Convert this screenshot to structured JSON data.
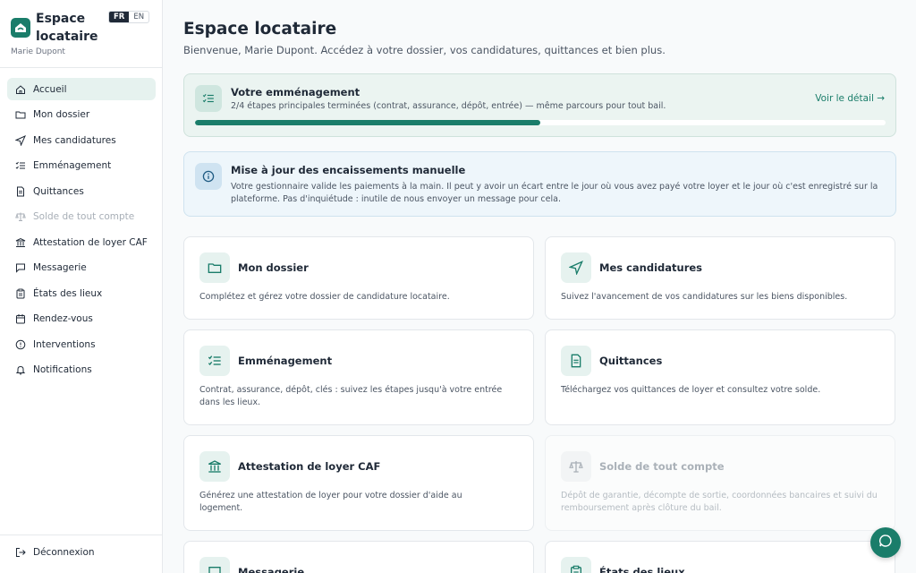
{
  "brand": {
    "name": "Espace locataire",
    "user": "Marie Dupont"
  },
  "lang": {
    "fr": "FR",
    "en": "EN"
  },
  "nav": [
    {
      "label": "Accueil",
      "icon": "home-icon",
      "active": true
    },
    {
      "label": "Mon dossier",
      "icon": "folder-icon"
    },
    {
      "label": "Mes candidatures",
      "icon": "send-icon"
    },
    {
      "label": "Emménagement",
      "icon": "checklist-icon"
    },
    {
      "label": "Quittances",
      "icon": "document-icon"
    },
    {
      "label": "Solde de tout compte",
      "icon": "scale-icon",
      "disabled": true
    },
    {
      "label": "Attestation de loyer CAF",
      "icon": "bank-icon"
    },
    {
      "label": "Messagerie",
      "icon": "message-icon"
    },
    {
      "label": "États des lieux",
      "icon": "clipboard-icon"
    },
    {
      "label": "Rendez-vous",
      "icon": "calendar-icon"
    },
    {
      "label": "Interventions",
      "icon": "alert-circle-icon"
    },
    {
      "label": "Notifications",
      "icon": "bell-icon"
    }
  ],
  "logout": {
    "label": "Déconnexion",
    "icon": "logout-icon"
  },
  "main": {
    "title": "Espace locataire",
    "subtitle": "Bienvenue, Marie Dupont. Accédez à votre dossier, vos candidatures, quittances et bien plus."
  },
  "progress": {
    "title": "Votre emménagement",
    "description": "2/4 étapes principales terminées (contrat, assurance, dépôt, entrée) — même parcours pour tout bail.",
    "link": "Voir le détail →",
    "fraction": 0.5
  },
  "info": {
    "title": "Mise à jour des encaissements manuelle",
    "description": "Votre gestionnaire valide les paiements à la main. Il peut y avoir un écart entre le jour où vous avez payé votre loyer et le jour où c'est enregistré sur la plateforme. Pas d'inquiétude : inutile de nous envoyer un message pour cela."
  },
  "tiles": [
    {
      "title": "Mon dossier",
      "description": "Complétez et gérez votre dossier de candidature locataire.",
      "icon": "folder-icon"
    },
    {
      "title": "Mes candidatures",
      "description": "Suivez l'avancement de vos candidatures sur les biens disponibles.",
      "icon": "send-icon"
    },
    {
      "title": "Emménagement",
      "description": "Contrat, assurance, dépôt, clés : suivez les étapes jusqu'à votre entrée dans les lieux.",
      "icon": "checklist-icon"
    },
    {
      "title": "Quittances",
      "description": "Téléchargez vos quittances de loyer et consultez votre solde.",
      "icon": "document-icon"
    },
    {
      "title": "Attestation de loyer CAF",
      "description": "Générez une attestation de loyer pour votre dossier d'aide au logement.",
      "icon": "bank-icon"
    },
    {
      "title": "Solde de tout compte",
      "description": "Dépôt de garantie, décompte de sortie, coordonnées bancaires et suivi du remboursement après clôture du bail.",
      "icon": "scale-icon",
      "disabled": true
    },
    {
      "title": "Messagerie",
      "description": "",
      "icon": "message-icon"
    },
    {
      "title": "États des lieux",
      "description": "",
      "icon": "clipboard-icon"
    }
  ],
  "colors": {
    "accent": "#1a7d6a",
    "accent_light": "#e6f2ef",
    "info": "#1e5a82"
  }
}
